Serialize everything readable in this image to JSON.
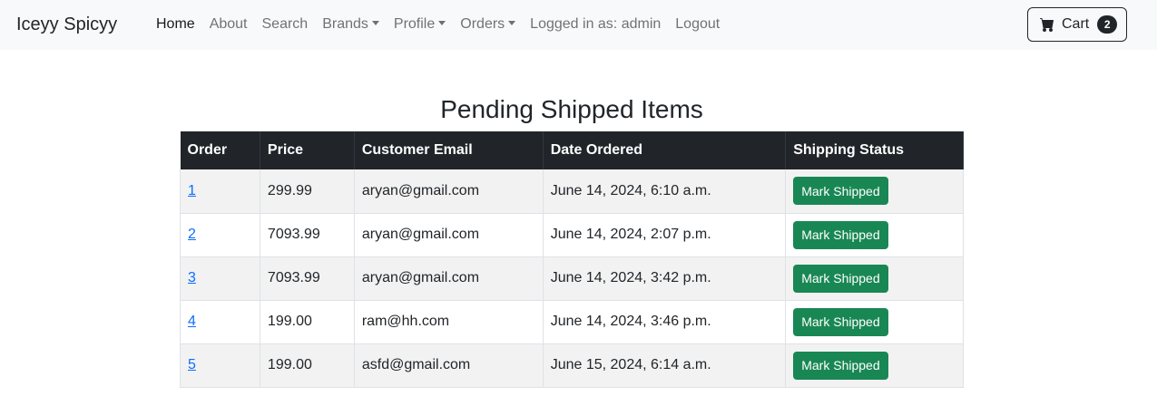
{
  "navbar": {
    "brand": "Iceyy Spicyy",
    "links": [
      {
        "label": "Home",
        "active": true,
        "dropdown": false
      },
      {
        "label": "About",
        "active": false,
        "dropdown": false
      },
      {
        "label": "Search",
        "active": false,
        "dropdown": false
      },
      {
        "label": "Brands",
        "active": false,
        "dropdown": true
      },
      {
        "label": "Profile",
        "active": false,
        "dropdown": true
      },
      {
        "label": "Orders",
        "active": false,
        "dropdown": true
      },
      {
        "label": "Logged in as: admin",
        "active": false,
        "dropdown": false
      },
      {
        "label": "Logout",
        "active": false,
        "dropdown": false
      }
    ],
    "cart": {
      "label": "Cart",
      "count": "2",
      "icon": "cart-icon"
    }
  },
  "page": {
    "title": "Pending Shipped Items"
  },
  "table": {
    "headers": [
      "Order",
      "Price",
      "Customer Email",
      "Date Ordered",
      "Shipping Status"
    ],
    "rows": [
      {
        "order": "1",
        "price": "299.99",
        "email": "aryan@gmail.com",
        "date": "June 14, 2024, 6:10 a.m.",
        "action": "Mark Shipped"
      },
      {
        "order": "2",
        "price": "7093.99",
        "email": "aryan@gmail.com",
        "date": "June 14, 2024, 2:07 p.m.",
        "action": "Mark Shipped"
      },
      {
        "order": "3",
        "price": "7093.99",
        "email": "aryan@gmail.com",
        "date": "June 14, 2024, 3:42 p.m.",
        "action": "Mark Shipped"
      },
      {
        "order": "4",
        "price": "199.00",
        "email": "ram@hh.com",
        "date": "June 14, 2024, 3:46 p.m.",
        "action": "Mark Shipped"
      },
      {
        "order": "5",
        "price": "199.00",
        "email": "asfd@gmail.com",
        "date": "June 15, 2024, 6:14 a.m.",
        "action": "Mark Shipped"
      }
    ]
  },
  "colors": {
    "navbar_bg": "#f8f9fa",
    "table_header_bg": "#212529",
    "success_button": "#198754",
    "link": "#0d6efd"
  }
}
